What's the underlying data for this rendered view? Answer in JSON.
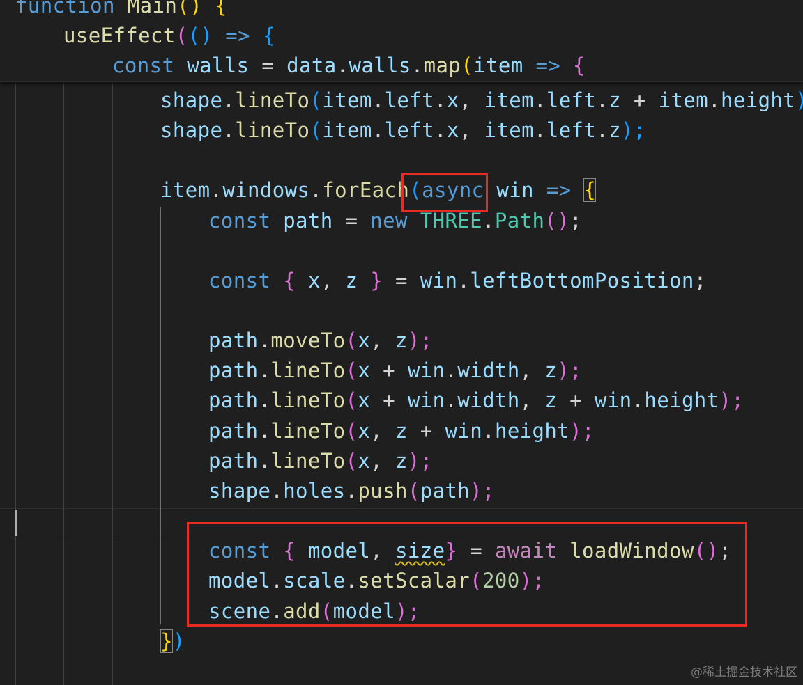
{
  "editor": {
    "sticky_lines": [
      {
        "kw": "function",
        "fn": "Main",
        "paren": "()",
        "brace": "{"
      },
      {
        "fn": "useEffect",
        "p_open": "(",
        "params": "()",
        "arrow": "=>",
        "brace": "{"
      },
      {
        "kw": "const",
        "var": "walls",
        "eq": "=",
        "obj": "data",
        "prop": "walls",
        "method": "map",
        "p_open": "(",
        "param": "item",
        "arrow": "=>",
        "brace": "{"
      }
    ],
    "line_shape_1": {
      "obj": "shape",
      "method": "lineTo",
      "a1": "item",
      "a2": "left",
      "a3": "x",
      "a4": "item",
      "a5": "left",
      "a6": "z",
      "op": "+",
      "a7": "item",
      "a8": "height",
      "end": ");"
    },
    "line_shape_2": {
      "obj": "shape",
      "method": "lineTo",
      "a1": "item",
      "a2": "left",
      "a3": "x",
      "a4": "item",
      "a5": "left",
      "a6": "z",
      "end": ");"
    },
    "line_foreach": {
      "obj": "item",
      "prop": "windows",
      "method": "forEach",
      "p_open": "(",
      "kw": "async",
      "param": "win",
      "arrow": "=>",
      "brace": "{"
    },
    "line_path": {
      "kw": "const",
      "var": "path",
      "eq": "=",
      "kw2": "new",
      "cls": "THREE",
      "ctor": "Path",
      "paren": "()",
      "end": ";"
    },
    "line_destructure": {
      "kw": "const",
      "b_open": "{",
      "v1": "x",
      "v2": "z",
      "b_close": "}",
      "eq": "=",
      "obj": "win",
      "prop": "leftBottomPosition",
      "end": ";"
    },
    "line_move": {
      "obj": "path",
      "method": "moveTo",
      "v1": "x",
      "v2": "z",
      "end": ");"
    },
    "line_l1": {
      "obj": "path",
      "method": "lineTo",
      "v1": "x",
      "op": "+",
      "o2": "win",
      "p2": "width",
      "v3": "z",
      "end": ");"
    },
    "line_l2": {
      "obj": "path",
      "method": "lineTo",
      "v1": "x",
      "op": "+",
      "o2": "win",
      "p2": "width",
      "v3": "z",
      "op2": "+",
      "o3": "win",
      "p3": "height",
      "end": ");"
    },
    "line_l3": {
      "obj": "path",
      "method": "lineTo",
      "v1": "x",
      "v2": "z",
      "op": "+",
      "o3": "win",
      "p3": "height",
      "end": ");"
    },
    "line_l4": {
      "obj": "path",
      "method": "lineTo",
      "v1": "x",
      "v2": "z",
      "end": ");"
    },
    "line_push": {
      "obj": "shape",
      "prop": "holes",
      "method": "push",
      "arg": "path",
      "end": ");"
    },
    "line_load": {
      "kw": "const",
      "b_open": "{",
      "v1": "model",
      "v2": "size",
      "b_close": "}",
      "eq": "=",
      "kw2": "await",
      "fn": "loadWindow",
      "paren": "()",
      "end": ";"
    },
    "line_scale": {
      "obj": "model",
      "prop": "scale",
      "method": "setScalar",
      "num": "200",
      "end": ");"
    },
    "line_add": {
      "obj": "scene",
      "method": "add",
      "arg": "model",
      "end": ");"
    },
    "line_close": {
      "brace": "}",
      "paren": ")"
    }
  },
  "watermark": "@稀土掘金技术社区",
  "colors": {
    "highlight_box": "#e82a22",
    "background": "#1f1f1f"
  }
}
